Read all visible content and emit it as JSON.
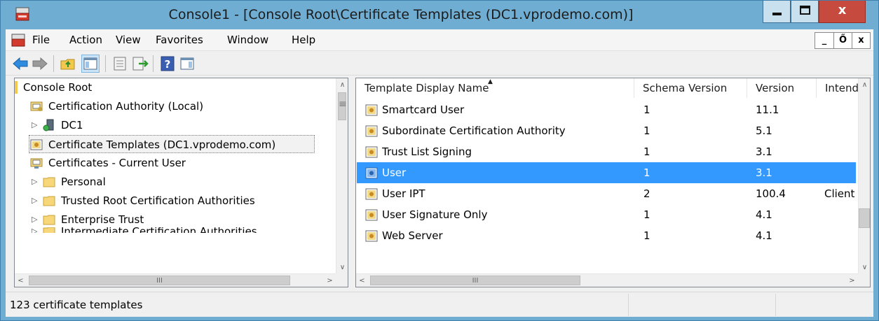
{
  "window": {
    "title": "Console1 - [Console Root\\Certificate Templates (DC1.vprodemo.com)]",
    "close_glyph": "x"
  },
  "menu": [
    "File",
    "Action",
    "View",
    "Favorites",
    "Window",
    "Help"
  ],
  "mdi_buttons": [
    "_",
    "Ő",
    "x"
  ],
  "tree": {
    "items": [
      {
        "label": "Console Root"
      },
      {
        "label": "Certification Authority (Local)"
      },
      {
        "label": "DC1",
        "expander": "▷"
      },
      {
        "label": "Certificate Templates (DC1.vprodemo.com)"
      },
      {
        "label": "Certificates - Current User"
      },
      {
        "label": "Personal",
        "expander": "▷"
      },
      {
        "label": "Trusted Root Certification Authorities",
        "expander": "▷"
      },
      {
        "label": "Enterprise Trust",
        "expander": "▷"
      },
      {
        "label": "Intermediate Certification Authorities",
        "expander": "▷"
      }
    ]
  },
  "list": {
    "columns": [
      "Template Display Name",
      "Schema Version",
      "Version",
      "Intend"
    ],
    "rows": [
      {
        "name": "Smartcard User",
        "schema": "1",
        "version": "11.1",
        "intended": ""
      },
      {
        "name": "Subordinate Certification Authority",
        "schema": "1",
        "version": "5.1",
        "intended": ""
      },
      {
        "name": "Trust List Signing",
        "schema": "1",
        "version": "3.1",
        "intended": ""
      },
      {
        "name": "User",
        "schema": "1",
        "version": "3.1",
        "intended": ""
      },
      {
        "name": "User IPT",
        "schema": "2",
        "version": "100.4",
        "intended": "Client"
      },
      {
        "name": "User Signature Only",
        "schema": "1",
        "version": "4.1",
        "intended": ""
      },
      {
        "name": "Web Server",
        "schema": "1",
        "version": "4.1",
        "intended": ""
      }
    ],
    "selected_row": "User",
    "sort_indicator": "▲"
  },
  "scroll_glyphs": {
    "up": "∧",
    "down": "∨",
    "left": "<",
    "right": ">",
    "grip": "≡",
    "hgrip": "III"
  },
  "status": {
    "text": "123 certificate templates"
  },
  "colors": {
    "title_bar": "#6faed2",
    "selection": "#3399ff",
    "close_button": "#c74a3f"
  }
}
